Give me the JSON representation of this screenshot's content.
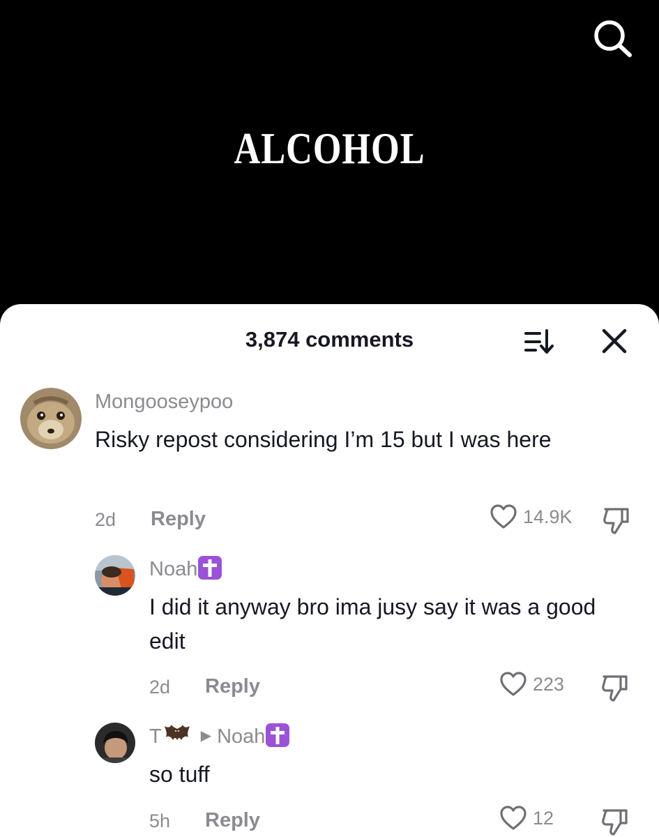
{
  "video": {
    "title": "ALCOHOL"
  },
  "sheet": {
    "comment_count": "3,874 comments"
  },
  "comments": [
    {
      "username": "Mongooseypoo",
      "text": "Risky repost considering I’m 15 but I was here",
      "time": "2d",
      "reply_label": "Reply",
      "likes": "14.9K"
    },
    {
      "username": "Noah",
      "text": "I did it anyway bro ima jusy say it was a good edit",
      "time": "2d",
      "reply_label": "Reply",
      "likes": "223"
    },
    {
      "username": "T",
      "reply_to": "Noah",
      "text": "so tuff",
      "time": "5h",
      "reply_label": "Reply",
      "likes": "12"
    }
  ],
  "icons": {
    "search": "search-icon",
    "sort": "sort-icon",
    "close": "close-icon",
    "like": "heart-icon",
    "dislike": "thumbs-down-icon",
    "badge": "latin-cross-emoji",
    "bat": "bat-emoji"
  },
  "colors": {
    "badge": "#9b52d6",
    "secondary_text": "#8a8b91",
    "primary_text": "#161823"
  }
}
